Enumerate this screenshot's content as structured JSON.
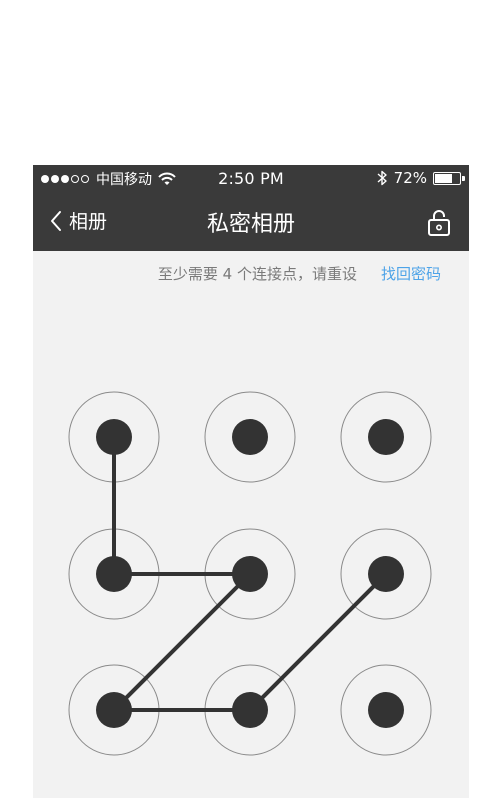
{
  "status_bar": {
    "carrier": "中国移动",
    "time": "2:50 PM",
    "battery": "72%",
    "battery_level": 0.72,
    "signal": [
      true,
      true,
      true,
      false,
      false
    ]
  },
  "nav": {
    "back_label": "相册",
    "title": "私密相册"
  },
  "hint": {
    "text": "至少需要 4 个连接点，请重设",
    "forgot_link": "找回密码"
  },
  "pattern": {
    "grid": [
      [
        0,
        1,
        2
      ],
      [
        3,
        4,
        5
      ],
      [
        6,
        7,
        8
      ]
    ],
    "drawn_sequence": [
      0,
      3,
      4,
      6,
      7,
      5
    ]
  },
  "colors": {
    "bar_bg": "#3a3a3a",
    "screen_bg": "#f2f2f2",
    "link": "#4da3e8",
    "hint": "#7a7a7a",
    "node": "#333333"
  }
}
